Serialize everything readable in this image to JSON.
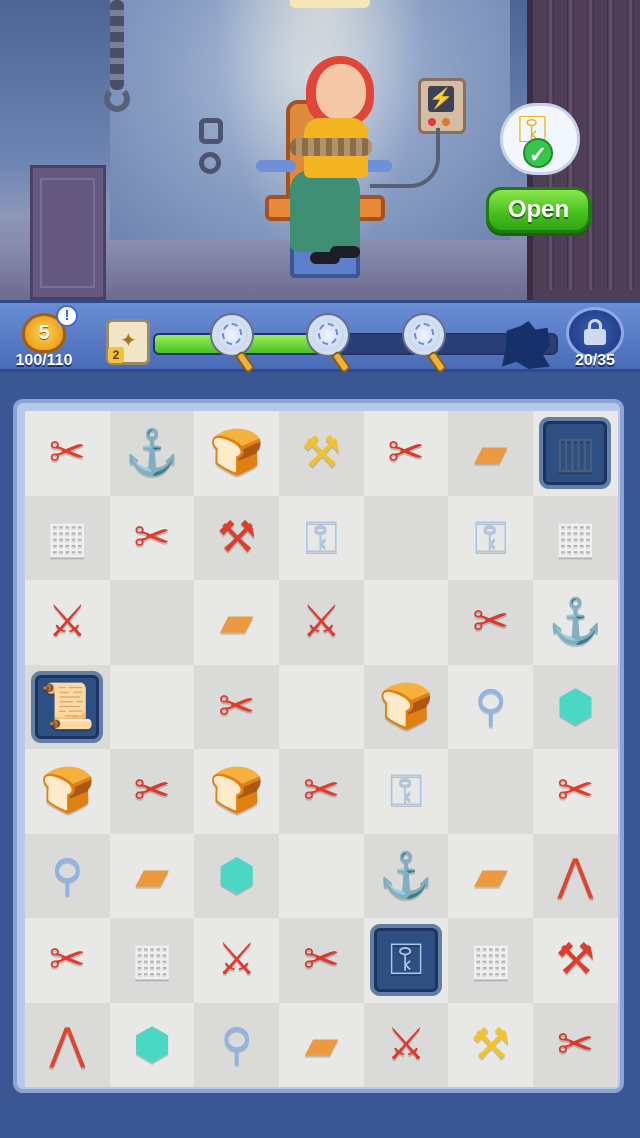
{
  "scene": {
    "open_button": "Open",
    "key_task": {
      "icon": "golden-key-icon",
      "status": "check-icon"
    },
    "panel_icon": "lightning-icon"
  },
  "hud": {
    "level": "5",
    "alert": "!",
    "xp": "100/110",
    "map_count": "2",
    "progress_fraction": 0.42,
    "lock_count": "20/35"
  },
  "board": {
    "rows": [
      [
        "pliers-icon",
        "hook-icon",
        "bread-icon",
        "drill-icon",
        "scissors-icon",
        "toast-icon",
        "bars-icon"
      ],
      [
        "saw-icon",
        "pliers-icon",
        "screwdriver-icon",
        "key-item-icon",
        "",
        "key-item-icon",
        "saw-icon"
      ],
      [
        "knife-icon",
        "",
        "toast-icon",
        "knife-icon",
        "",
        "scissors-icon",
        "hook-icon"
      ],
      [
        "scroll-icon",
        "",
        "pliers-icon",
        "",
        "bread-icon",
        "magnifier-item-icon",
        "gem-icon"
      ],
      [
        "bread-icon",
        "scissors-icon",
        "bread-icon",
        "pliers-icon",
        "key-item-icon",
        "",
        "pliers-icon"
      ],
      [
        "magnifier-item-icon",
        "toast-icon",
        "gem-icon",
        "",
        "hook-icon",
        "toast-icon",
        "tongs-icon"
      ],
      [
        "pliers-icon",
        "saw-icon",
        "knife-icon",
        "scissors-icon",
        "key-item-icon",
        "saw-icon",
        "screwdriver-icon"
      ],
      [
        "tongs-icon",
        "gem-icon",
        "magnifier-item-icon",
        "toast-icon",
        "knife-icon",
        "drill-icon",
        "scissors-icon"
      ]
    ],
    "framed_cells": [
      "0-6",
      "3-0",
      "6-4"
    ]
  }
}
